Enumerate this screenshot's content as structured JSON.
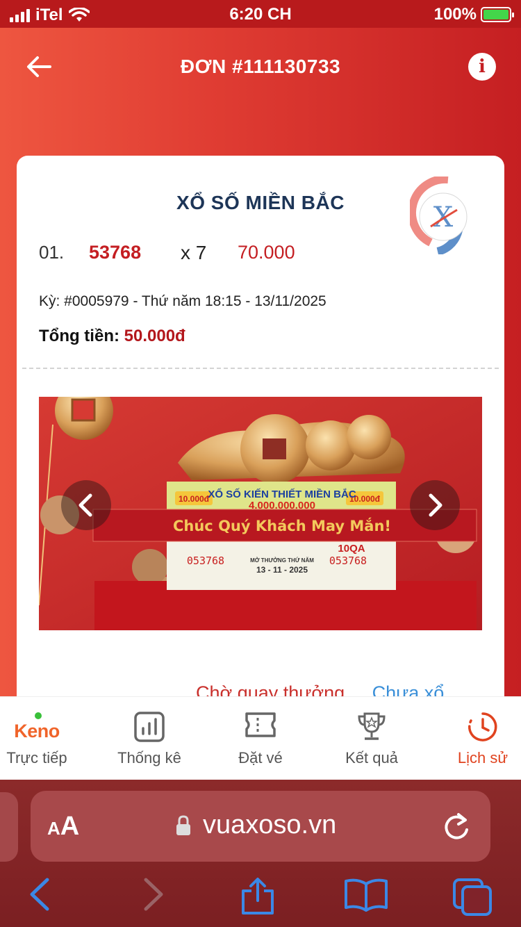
{
  "status_bar": {
    "carrier": "iTel",
    "time": "6:20 CH",
    "battery": "100%"
  },
  "header": {
    "title": "ĐƠN #111130733"
  },
  "order": {
    "lottery_name": "XỔ SỐ MIỀN BẮC",
    "ticket": {
      "index": "01.",
      "number": "53768",
      "multiplier": "x 7",
      "amount": "70.000"
    },
    "draw_info": "Kỳ: #0005979 - Thứ năm 18:15 - 13/11/2025",
    "total_label": "Tổng tiền:",
    "total_value": "50.000đ",
    "image_caption": "Chúc Quý Khách May Mắn!",
    "ticket_image_texts": {
      "price_left": "10.000đ",
      "price_right": "10.000đ",
      "heading": "XỔ SỐ KIẾN THIẾT MIỀN BẮC",
      "prize": "4.000.000.000",
      "code": "10QA",
      "serial_left": "053768",
      "serial_right": "053768",
      "draw_label": "MỞ THƯỞNG THỨ NĂM",
      "draw_date": "13 - 11 - 2025"
    },
    "status_waiting": "Chờ quay thưởng",
    "status_not_drawn": "Chưa xổ"
  },
  "tabs": [
    {
      "logo": "Keno",
      "label": "Trực tiếp",
      "icon": "keno-logo"
    },
    {
      "label": "Thống kê",
      "icon": "chart-icon"
    },
    {
      "label": "Đặt vé",
      "icon": "ticket-icon"
    },
    {
      "label": "Kết quả",
      "icon": "trophy-icon"
    },
    {
      "label": "Lịch sử",
      "icon": "clock-icon",
      "active": true
    }
  ],
  "browser": {
    "aa_small": "A",
    "aa_big": "A",
    "url": "vuaxoso.vn"
  },
  "colors": {
    "brand_red": "#c41e22",
    "accent_orange": "#e0431f",
    "link_blue": "#3a8fd8",
    "title_navy": "#1d3557"
  }
}
